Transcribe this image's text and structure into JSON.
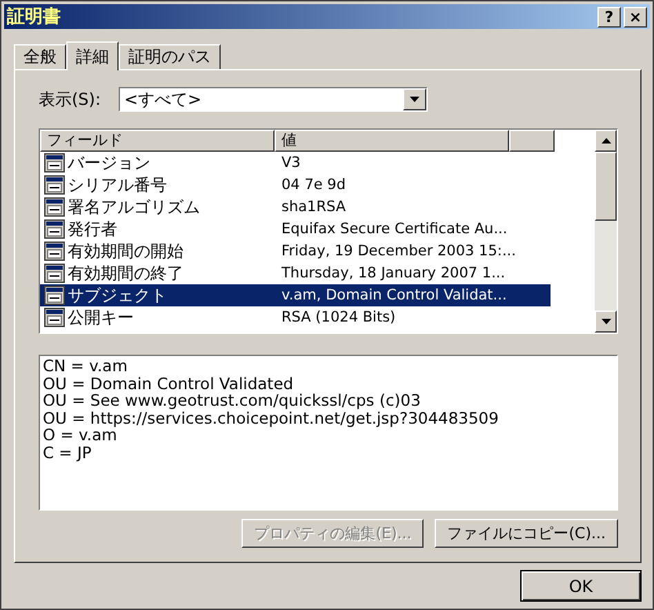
{
  "window": {
    "title": "証明書",
    "help_button": "?",
    "close_button": "×"
  },
  "tabs": [
    {
      "label": "全般",
      "selected": false
    },
    {
      "label": "詳細",
      "selected": true
    },
    {
      "label": "証明のパス",
      "selected": false
    }
  ],
  "show": {
    "label": "表示(S):",
    "value": "<すべて>"
  },
  "table": {
    "columns": [
      "フィールド",
      "値"
    ],
    "rows": [
      {
        "field": "バージョン",
        "value": "V3",
        "selected": false
      },
      {
        "field": "シリアル番号",
        "value": "04 7e 9d",
        "selected": false
      },
      {
        "field": "署名アルゴリズム",
        "value": "sha1RSA",
        "selected": false
      },
      {
        "field": "発行者",
        "value": "Equifax Secure Certificate Au...",
        "selected": false
      },
      {
        "field": "有効期間の開始",
        "value": "Friday, 19 December 2003 15:...",
        "selected": false
      },
      {
        "field": "有効期間の終了",
        "value": "Thursday, 18 January 2007 1...",
        "selected": false
      },
      {
        "field": "サブジェクト",
        "value": "v.am, Domain Control Validat...",
        "selected": true
      },
      {
        "field": "公開キー",
        "value": "RSA (1024 Bits)",
        "selected": false
      }
    ]
  },
  "details": [
    "CN = v.am",
    "OU = Domain Control Validated",
    "OU = See www.geotrust.com/quickssl/cps (c)03",
    "OU = https://services.choicepoint.net/get.jsp?304483509",
    "O = v.am",
    "C = JP"
  ],
  "buttons": [
    {
      "label": "プロパティの編集(E)...",
      "disabled": true
    },
    {
      "label": "ファイルにコピー(C)...",
      "disabled": false
    }
  ],
  "ok_button": "OK"
}
